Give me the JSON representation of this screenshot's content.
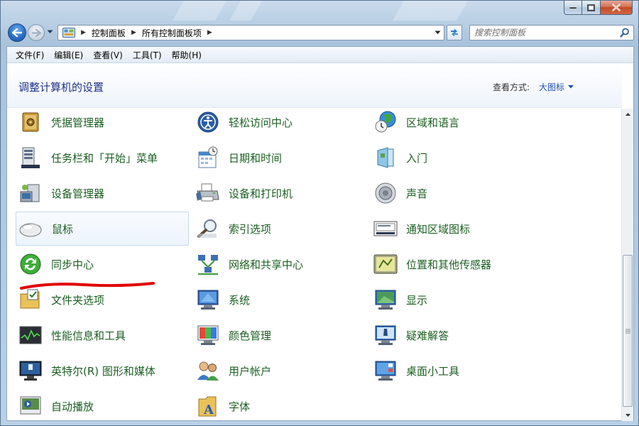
{
  "window": {
    "controls": {
      "minimize": "minimize",
      "maximize": "maximize",
      "close": "close"
    }
  },
  "nav": {
    "breadcrumbs": [
      "控制面板",
      "所有控制面板项"
    ],
    "search_placeholder": "搜索控制面板"
  },
  "menubar": [
    "文件(F)",
    "编辑(E)",
    "查看(V)",
    "工具(T)",
    "帮助(H)"
  ],
  "header": {
    "title": "调整计算机的设置",
    "view_by_label": "查看方式:",
    "view_by_value": "大图标"
  },
  "items": [
    [
      "凭据管理器",
      "轻松访问中心",
      "区域和语言"
    ],
    [
      "任务栏和「开始」菜单",
      "日期和时间",
      "入门"
    ],
    [
      "设备管理器",
      "设备和打印机",
      "声音"
    ],
    [
      "鼠标",
      "索引选项",
      "通知区域图标"
    ],
    [
      "同步中心",
      "网络和共享中心",
      "位置和其他传感器"
    ],
    [
      "文件夹选项",
      "系统",
      "显示"
    ],
    [
      "性能信息和工具",
      "颜色管理",
      "疑难解答"
    ],
    [
      "英特尔(R) 图形和媒体",
      "用户帐户",
      "桌面小工具"
    ],
    [
      "自动播放",
      "字体",
      ""
    ]
  ],
  "selected_item": "鼠标",
  "colors": {
    "item_text": "#1c5f22",
    "title_text": "#1e3287",
    "link_text": "#1e50b4",
    "annotation_red": "#e00000"
  }
}
